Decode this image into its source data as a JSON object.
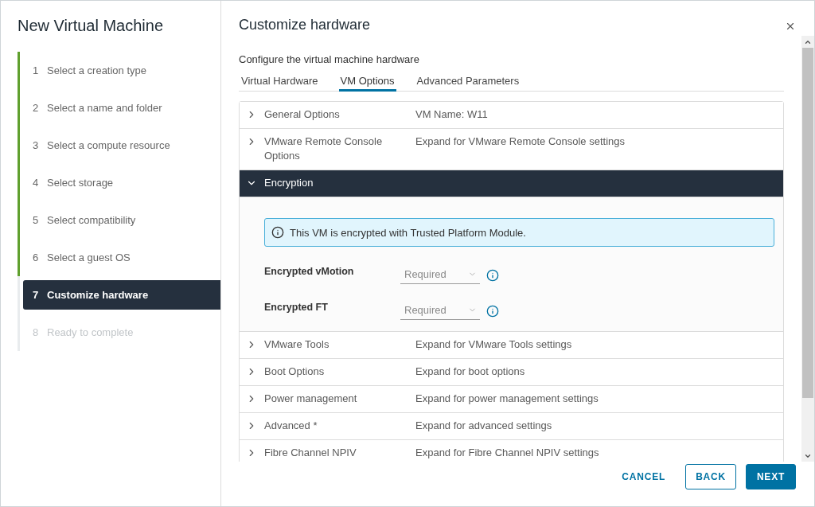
{
  "wizard": {
    "title": "New Virtual Machine",
    "steps": [
      {
        "number": "1",
        "label": "Select a creation type",
        "completed": true,
        "selected": false,
        "disabled": false
      },
      {
        "number": "2",
        "label": "Select a name and folder",
        "completed": true,
        "selected": false,
        "disabled": false
      },
      {
        "number": "3",
        "label": "Select a compute resource",
        "completed": true,
        "selected": false,
        "disabled": false
      },
      {
        "number": "4",
        "label": "Select storage",
        "completed": true,
        "selected": false,
        "disabled": false
      },
      {
        "number": "5",
        "label": "Select compatibility",
        "completed": true,
        "selected": false,
        "disabled": false
      },
      {
        "number": "6",
        "label": "Select a guest OS",
        "completed": true,
        "selected": false,
        "disabled": false
      },
      {
        "number": "7",
        "label": "Customize hardware",
        "completed": false,
        "selected": true,
        "disabled": false
      },
      {
        "number": "8",
        "label": "Ready to complete",
        "completed": false,
        "selected": false,
        "disabled": true
      }
    ]
  },
  "panel": {
    "title": "Customize hardware",
    "subtitle": "Configure the virtual machine hardware"
  },
  "tabs": [
    {
      "label": "Virtual Hardware",
      "selected": false
    },
    {
      "label": "VM Options",
      "selected": true
    },
    {
      "label": "Advanced Parameters",
      "selected": false
    }
  ],
  "sections": [
    {
      "label": "General Options",
      "summary": "VM Name: W11",
      "expanded": false
    },
    {
      "label": "VMware Remote Console Options",
      "summary": "Expand for VMware Remote Console settings",
      "expanded": false
    },
    {
      "label": "Encryption",
      "expanded": true,
      "alert": "This VM is encrypted with Trusted Platform Module.",
      "fields": [
        {
          "label": "Encrypted vMotion",
          "value": "Required"
        },
        {
          "label": "Encrypted FT",
          "value": "Required"
        }
      ]
    },
    {
      "label": "VMware Tools",
      "summary": "Expand for VMware Tools settings",
      "expanded": false
    },
    {
      "label": "Boot Options",
      "summary": "Expand for boot options",
      "expanded": false
    },
    {
      "label": "Power management",
      "summary": "Expand for power management settings",
      "expanded": false
    },
    {
      "label": "Advanced *",
      "summary": "Expand for advanced settings",
      "expanded": false
    },
    {
      "label": "Fibre Channel NPIV",
      "summary": "Expand for Fibre Channel NPIV settings",
      "expanded": false
    }
  ],
  "buttons": [
    {
      "label": "CANCEL",
      "kind": "link"
    },
    {
      "label": "BACK",
      "kind": "outline"
    },
    {
      "label": "NEXT",
      "kind": "primary"
    }
  ]
}
